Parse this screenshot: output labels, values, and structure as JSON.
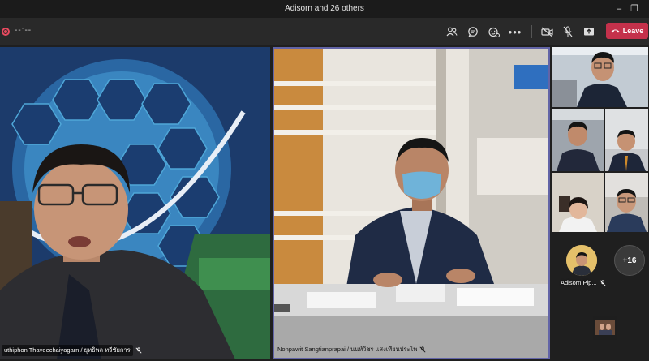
{
  "window": {
    "title": "Adisorn and 26 others"
  },
  "toolbar": {
    "timer": "--:--",
    "leave_label": "Leave"
  },
  "participants": {
    "main_left": {
      "name": "uthiphon Thaveechaiyagarn / ยุทธิพล ทวีชัยการ"
    },
    "main_center": {
      "name": "Nonpawit Sangtianprapai / นนท์วิชร แสงเทียนประไพ"
    },
    "overflow_count": "+16",
    "adisorn_name": "Adisorn Pip..."
  },
  "colors": {
    "accent": "#6264a7",
    "leave": "#c4314b",
    "recording": "#e84a5f"
  }
}
